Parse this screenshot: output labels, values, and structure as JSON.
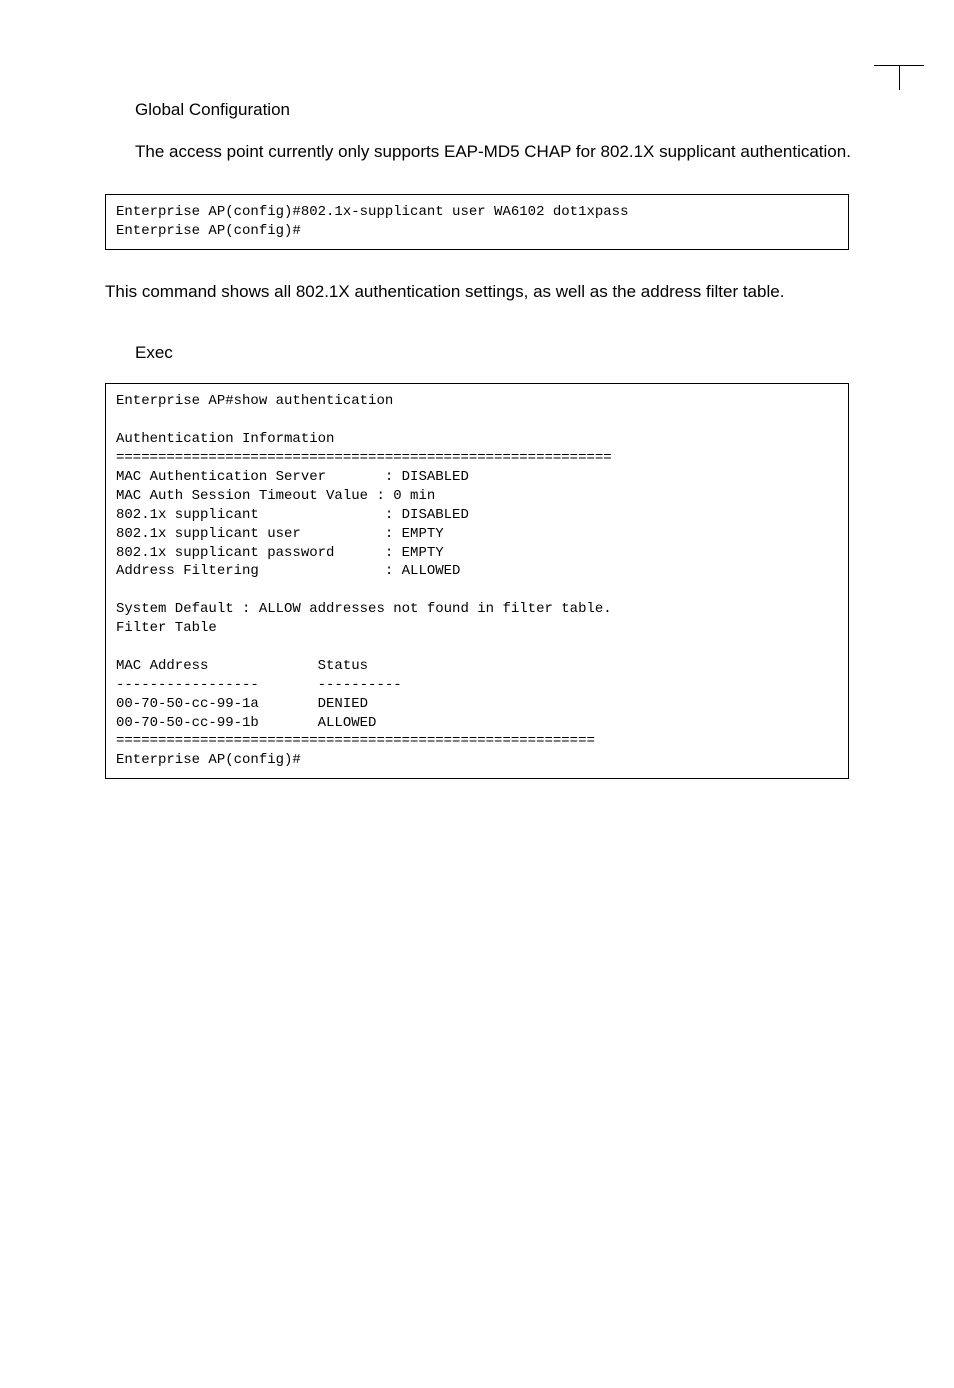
{
  "section1": {
    "heading": "Global Configuration",
    "body": "The access point currently only supports EAP-MD5 CHAP for 802.1X supplicant authentication."
  },
  "code1": "Enterprise AP(config)#802.1x-supplicant user WA6102 dot1xpass\nEnterprise AP(config)#",
  "section2": {
    "body": "This command shows all 802.1X authentication settings, as well as the address filter table.",
    "heading": "Exec"
  },
  "code2": "Enterprise AP#show authentication\n\nAuthentication Information\n===========================================================\nMAC Authentication Server       : DISABLED\nMAC Auth Session Timeout Value : 0 min\n802.1x supplicant               : DISABLED\n802.1x supplicant user          : EMPTY\n802.1x supplicant password      : EMPTY\nAddress Filtering               : ALLOWED\n\nSystem Default : ALLOW addresses not found in filter table.\nFilter Table\n\nMAC Address             Status\n-----------------       ----------\n00-70-50-cc-99-1a       DENIED\n00-70-50-cc-99-1b       ALLOWED\n=========================================================\nEnterprise AP(config)#"
}
